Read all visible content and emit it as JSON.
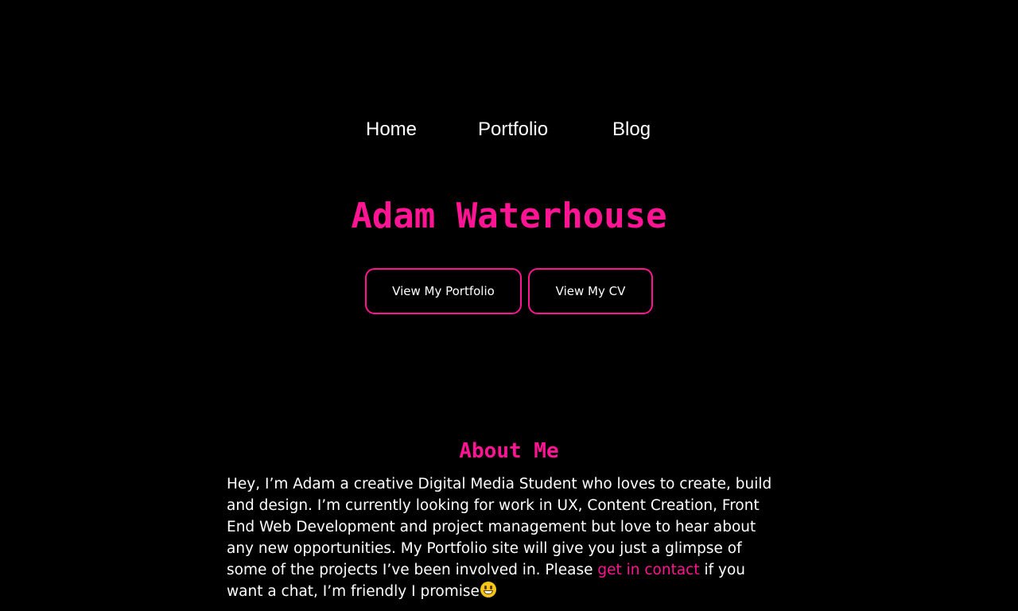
{
  "nav": {
    "home": "Home",
    "portfolio": "Portfolio",
    "blog": "Blog"
  },
  "hero": {
    "title": "Adam Waterhouse",
    "portfolio_button": "View My Portfolio",
    "cv_button": "View My CV"
  },
  "about": {
    "heading": "About Me",
    "text_before_link": "Hey, I’m Adam a creative Digital Media Student who loves to create, build and design. I’m currently looking for work in UX, Content Creation, Front End Web Development and project management but love to hear about any new opportunities. My Portfolio site will give you just a glimpse of some of the projects I’ve been involved in. Please ",
    "link_text": "get in contact",
    "text_after_link": " if you want a chat, I’m friendly I promise",
    "emoji_icon": "grinning-face-icon"
  },
  "colors": {
    "background": "#000000",
    "accent": "#ff1493",
    "text": "#ffffff"
  }
}
